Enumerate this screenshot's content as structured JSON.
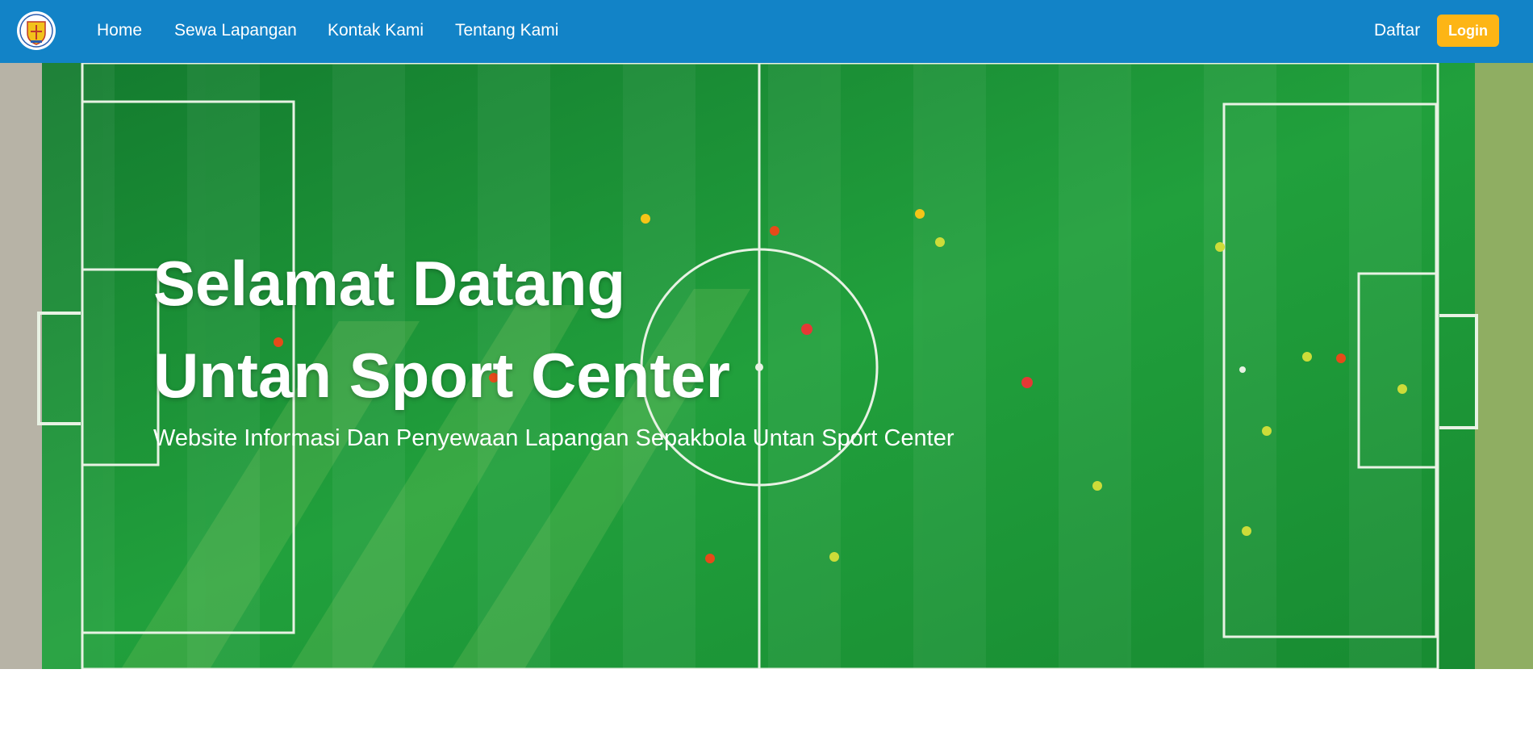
{
  "nav": {
    "links": [
      "Home",
      "Sewa Lapangan",
      "Kontak Kami",
      "Tentang Kami"
    ],
    "register_label": "Daftar",
    "login_label": "Login"
  },
  "hero": {
    "title_line1": "Selamat Datang",
    "title_line2": "Untan Sport Center",
    "subtitle": "Website Informasi Dan Penyewaan Lapangan Sepakbola Untan Sport Center"
  },
  "colors": {
    "navbar": "#1283c7",
    "login_button": "#fdb515",
    "pitch": "#1f9a3a"
  }
}
